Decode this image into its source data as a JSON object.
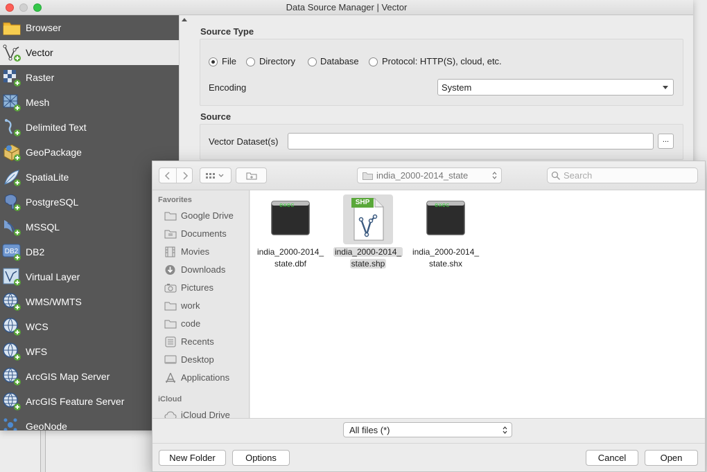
{
  "window": {
    "title": "Data Source Manager | Vector"
  },
  "sidebar": {
    "items": [
      {
        "label": "Browser",
        "icon": "folder-icon"
      },
      {
        "label": "Vector",
        "icon": "vector-layer-icon",
        "selected": true
      },
      {
        "label": "Raster",
        "icon": "raster-layer-icon"
      },
      {
        "label": "Mesh",
        "icon": "mesh-layer-icon"
      },
      {
        "label": "Delimited Text",
        "icon": "delimited-text-icon"
      },
      {
        "label": "GeoPackage",
        "icon": "geopackage-icon"
      },
      {
        "label": "SpatiaLite",
        "icon": "spatialite-icon"
      },
      {
        "label": "PostgreSQL",
        "icon": "postgresql-icon"
      },
      {
        "label": "MSSQL",
        "icon": "mssql-icon"
      },
      {
        "label": "DB2",
        "icon": "db2-icon"
      },
      {
        "label": "Virtual Layer",
        "icon": "virtual-layer-icon"
      },
      {
        "label": "WMS/WMTS",
        "icon": "wms-icon"
      },
      {
        "label": "WCS",
        "icon": "wcs-icon"
      },
      {
        "label": "WFS",
        "icon": "wfs-icon"
      },
      {
        "label": "ArcGIS Map Server",
        "icon": "arcgis-map-icon"
      },
      {
        "label": "ArcGIS Feature Server",
        "icon": "arcgis-feature-icon"
      },
      {
        "label": "GeoNode",
        "icon": "geonode-icon"
      }
    ]
  },
  "source_type": {
    "title": "Source Type",
    "options": [
      "File",
      "Directory",
      "Database",
      "Protocol: HTTP(S), cloud, etc."
    ],
    "selected": "File",
    "encoding_label": "Encoding",
    "encoding_value": "System"
  },
  "source": {
    "title": "Source",
    "dataset_label": "Vector Dataset(s)",
    "dataset_value": "",
    "browse_label": "..."
  },
  "file_dialog": {
    "current_folder": "india_2000-2014_state",
    "search_placeholder": "Search",
    "favorites_header": "Favorites",
    "favorites": [
      {
        "label": "Google Drive",
        "icon": "folder-icon"
      },
      {
        "label": "Documents",
        "icon": "documents-icon"
      },
      {
        "label": "Movies",
        "icon": "movies-icon"
      },
      {
        "label": "Downloads",
        "icon": "downloads-icon"
      },
      {
        "label": "Pictures",
        "icon": "pictures-icon"
      },
      {
        "label": "work",
        "icon": "folder-icon"
      },
      {
        "label": "code",
        "icon": "folder-icon"
      },
      {
        "label": "Recents",
        "icon": "recents-icon"
      },
      {
        "label": "Desktop",
        "icon": "desktop-icon"
      },
      {
        "label": "Applications",
        "icon": "applications-icon"
      }
    ],
    "icloud_header": "iCloud",
    "icloud": [
      {
        "label": "iCloud Drive",
        "icon": "cloud-icon"
      }
    ],
    "files": [
      {
        "line1": "india_2000-2014_",
        "line2": "state.dbf",
        "kind_label": "exec",
        "selected": false
      },
      {
        "line1": "india_2000-2014_",
        "line2": "state.shp",
        "kind_label": "SHP",
        "selected": true
      },
      {
        "line1": "india_2000-2014_",
        "line2": "state.shx",
        "kind_label": "exec",
        "selected": false
      }
    ],
    "filter_value": "All files (*)",
    "buttons": {
      "new_folder": "New Folder",
      "options": "Options",
      "cancel": "Cancel",
      "open": "Open"
    }
  },
  "colors": {
    "sidebar_bg": "#575757",
    "selected_item_bg": "#e9e9e9",
    "shp_badge": "#5aa83a"
  }
}
